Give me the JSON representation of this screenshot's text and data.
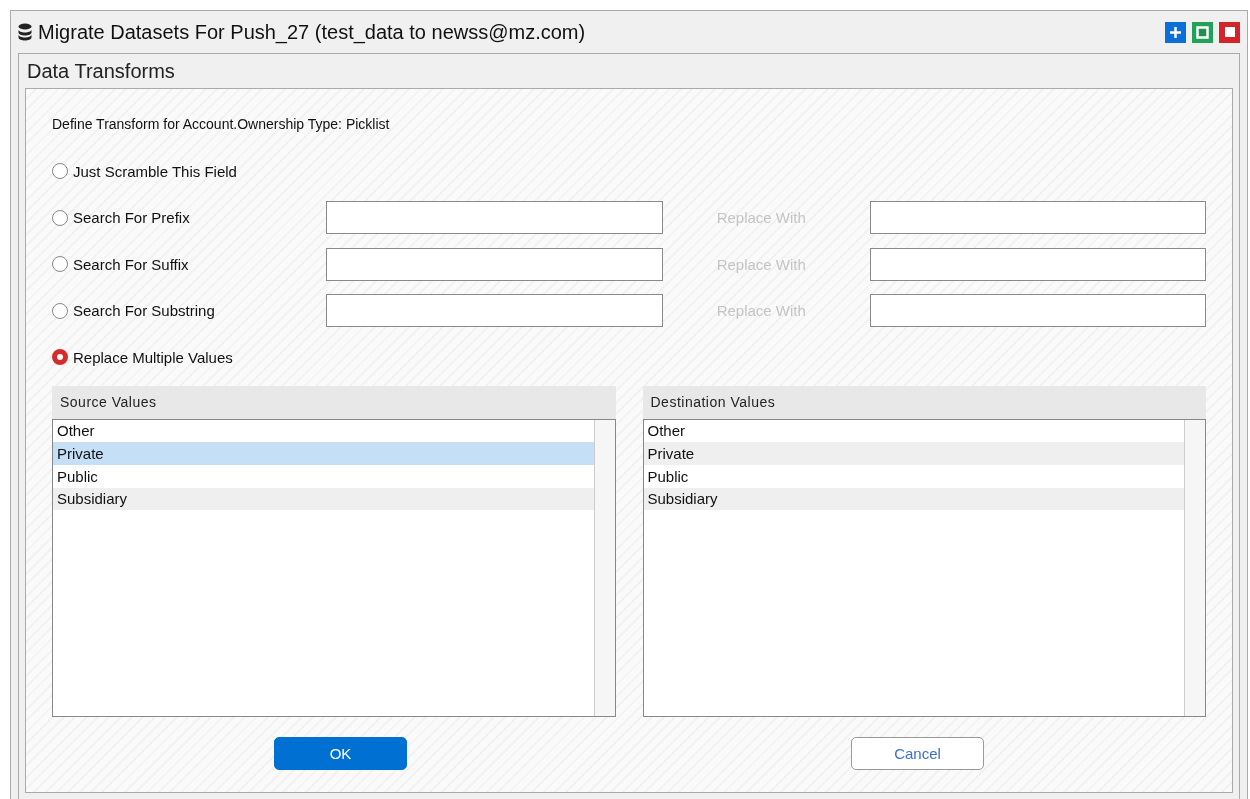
{
  "window": {
    "title": "Migrate Datasets For Push_27 (test_data to newss@mz.com)"
  },
  "panel": {
    "title": "Data Transforms"
  },
  "heading": "Define Transform for Account.Ownership Type: Picklist",
  "options": [
    {
      "kind": "plain",
      "label": "Just Scramble This Field",
      "selected": false
    },
    {
      "kind": "search",
      "label": "Search For Prefix",
      "selected": false,
      "replace_label": "Replace With"
    },
    {
      "kind": "search",
      "label": "Search For Suffix",
      "selected": false,
      "replace_label": "Replace With"
    },
    {
      "kind": "search",
      "label": "Search For Substring",
      "selected": false,
      "replace_label": "Replace With"
    },
    {
      "kind": "plain",
      "label": "Replace Multiple Values",
      "selected": true
    }
  ],
  "lists": [
    {
      "title": "Source Values",
      "items": [
        {
          "label": "Other",
          "selected": false
        },
        {
          "label": "Private",
          "selected": true
        },
        {
          "label": "Public",
          "selected": false
        },
        {
          "label": "Subsidiary",
          "selected": false
        }
      ]
    },
    {
      "title": "Destination Values",
      "items": [
        {
          "label": "Other",
          "selected": false
        },
        {
          "label": "Private",
          "selected": false
        },
        {
          "label": "Public",
          "selected": false
        },
        {
          "label": "Subsidiary",
          "selected": false
        }
      ]
    }
  ],
  "buttons": [
    {
      "kind": "primary",
      "label": "OK"
    },
    {
      "kind": "secondary",
      "label": "Cancel"
    }
  ]
}
